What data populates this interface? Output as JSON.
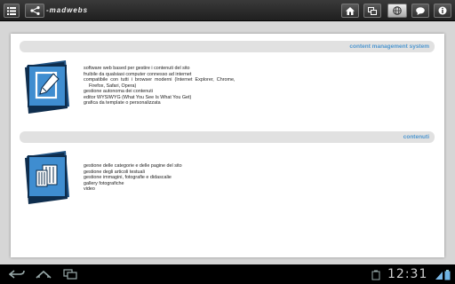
{
  "app": {
    "brand": "-madwebs",
    "icons": [
      "menu-icon",
      "share-icon",
      "home-icon",
      "windows-icon",
      "globe-icon",
      "chat-icon",
      "info-icon"
    ]
  },
  "sections": [
    {
      "title": "content management system",
      "icon": "edit-document-icon",
      "items": [
        "software web based per gestire i contenuti del sito",
        "fruibile da qualsiasi computer connesso ad internet",
        "compatibile  con  tutti  i  browser  moderni  (Internet  Explorer,  Chrome,",
        "    Firefox, Safari, Opera)",
        "gestione autonoma dei contenuti",
        "editor WYSIWYG (What You See Is What You Get)",
        "grafica da template o personalizzata"
      ]
    },
    {
      "title": "contenuti",
      "icon": "copy-documents-icon",
      "items": [
        "gestione delle categorie e delle pagine del sito",
        "gestione degli articoli testuali",
        "gestione immagini, fotografie e didascalie",
        "gallery fotografiche",
        "video"
      ]
    }
  ],
  "system_bar": {
    "time": "12:31",
    "icons": [
      "back-icon",
      "home-nav-icon",
      "recent-apps-icon",
      "notification-icon",
      "wifi-icon",
      "battery-icon"
    ]
  },
  "colors": {
    "accent": "#4e97d0",
    "icon_blue": "#3f8dd0",
    "section_bar": "#e1e1e1"
  }
}
